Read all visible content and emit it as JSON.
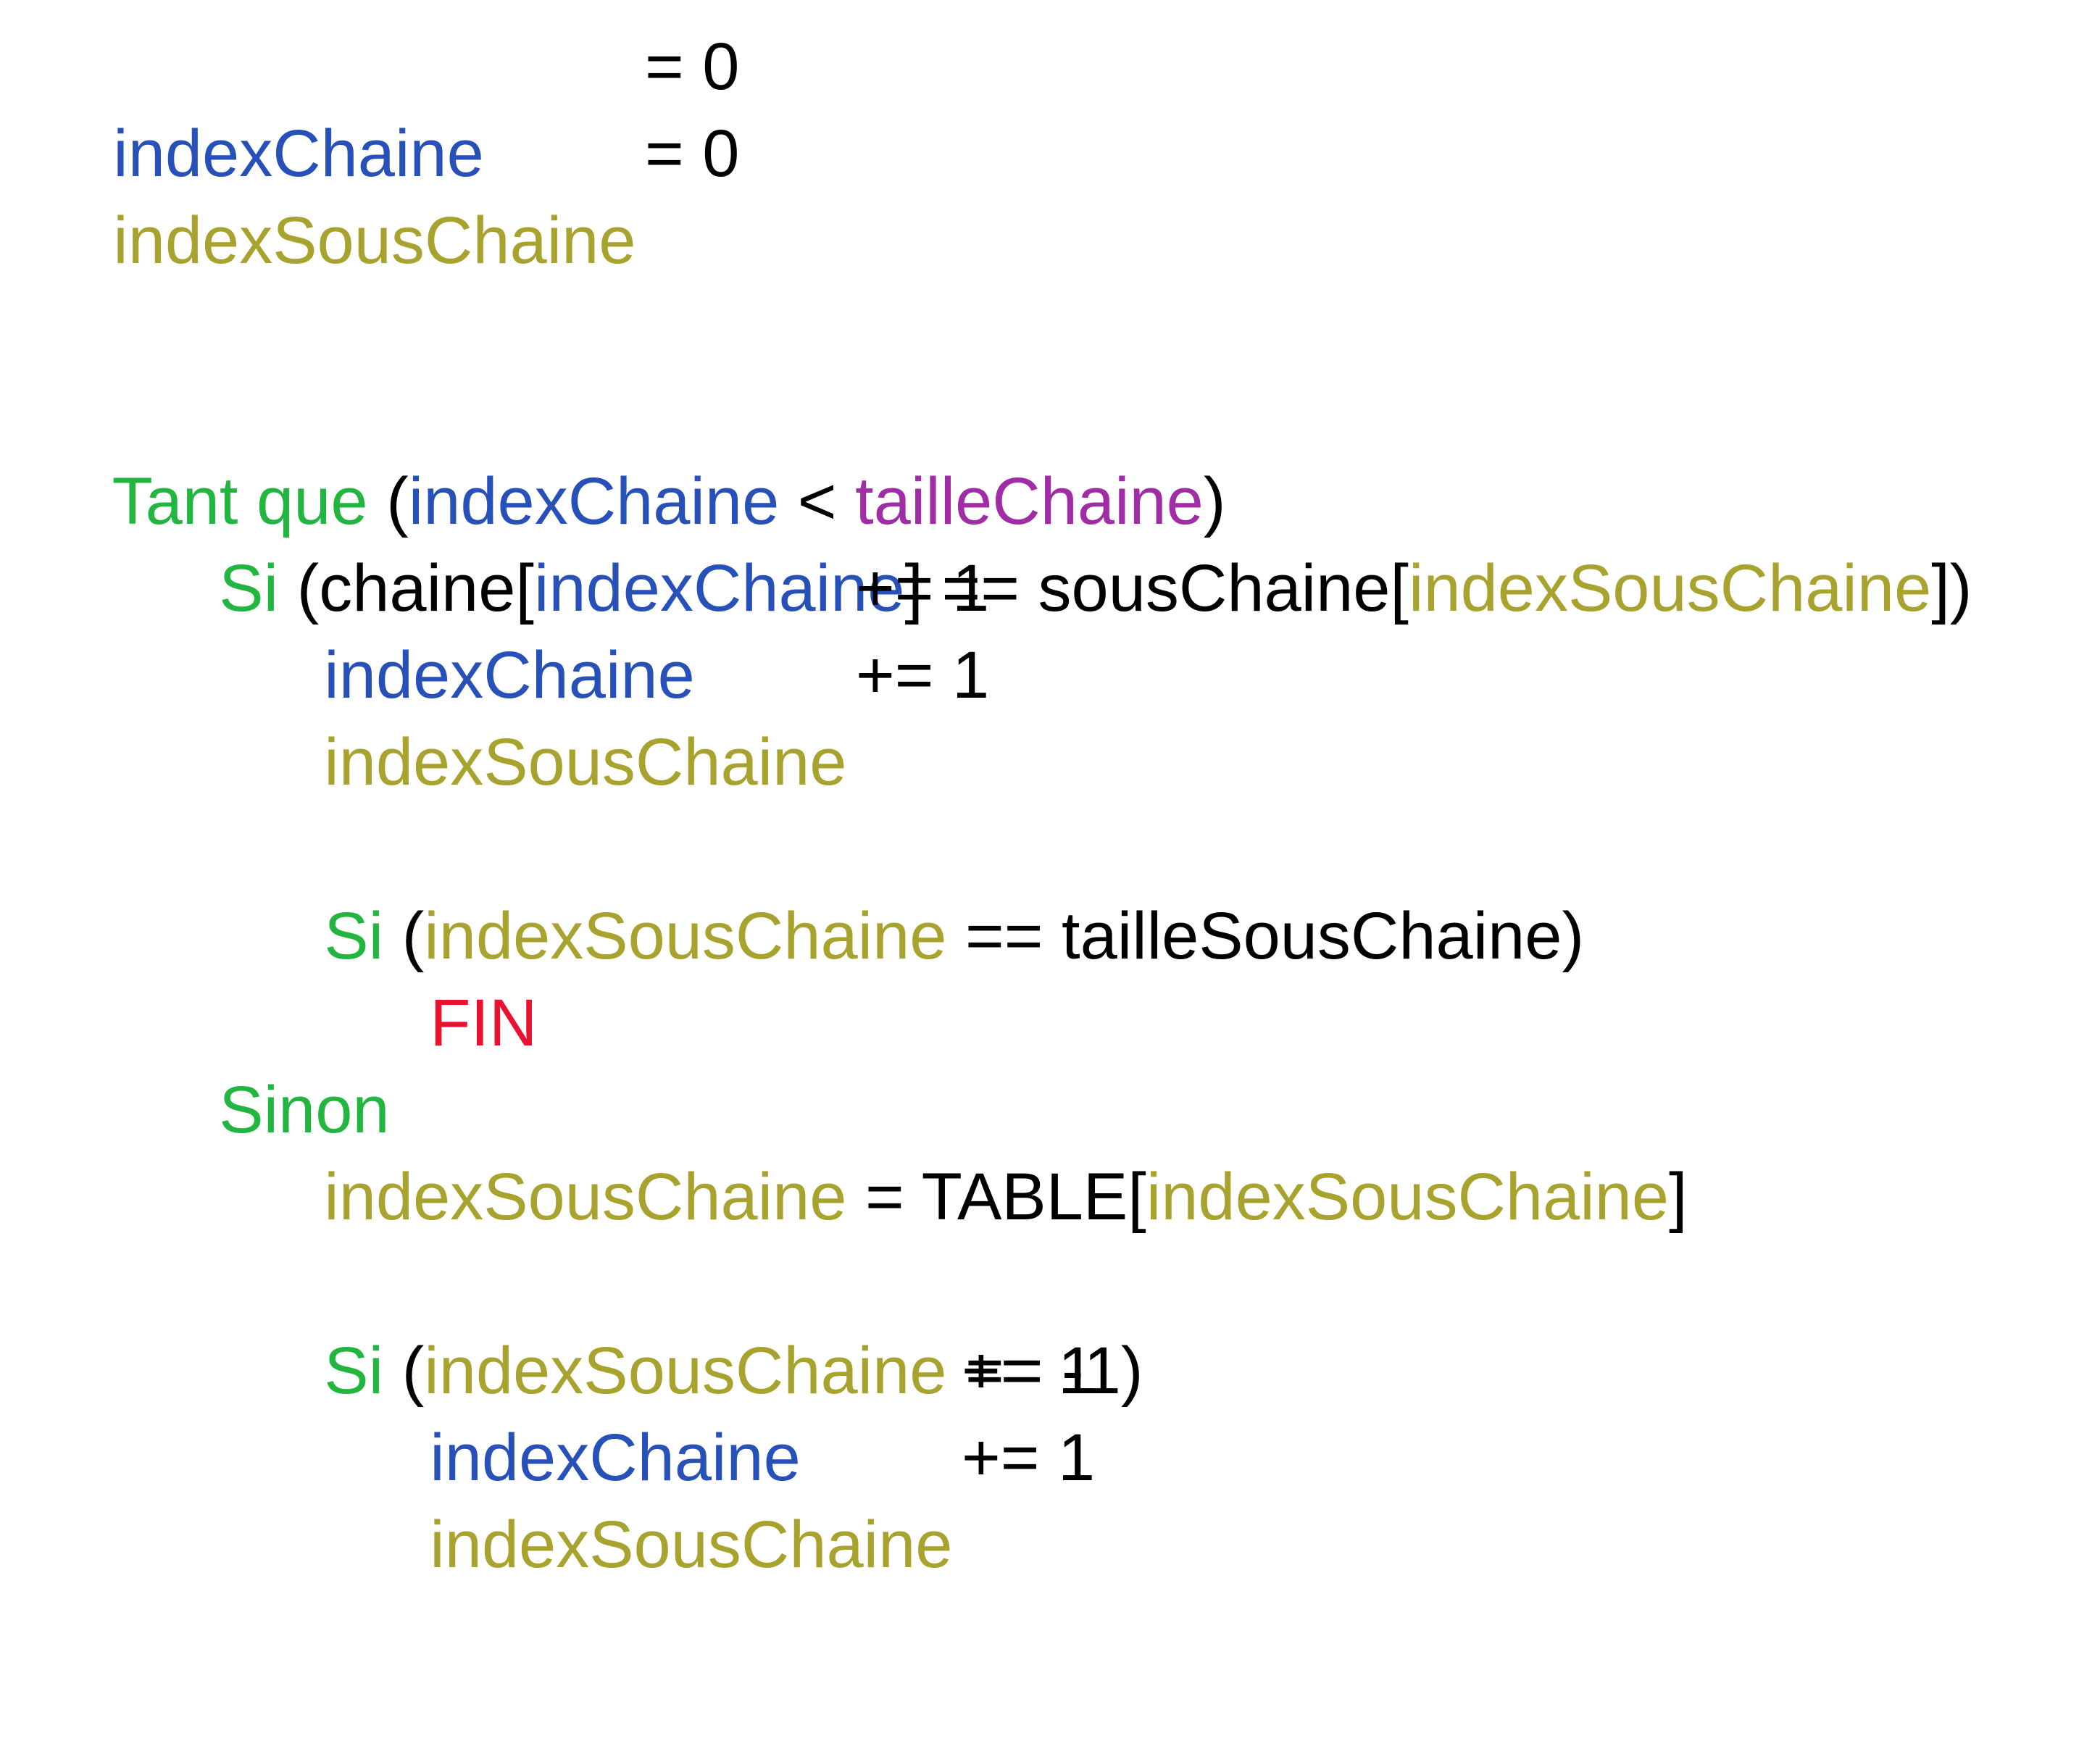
{
  "colors": {
    "variable_index_chaine": "#2750b8",
    "variable_index_sous_chaine": "#a8a22e",
    "keyword": "#22b540",
    "constant": "#a12da6",
    "end_statement": "#e8112f",
    "default": "#000000"
  },
  "lines": [
    [
      {
        "text": "indexChaine",
        "color": "#2750b8"
      },
      {
        "text": "= 0",
        "color": "#000000",
        "col": 890
      }
    ],
    [
      {
        "text": "indexSousChaine",
        "color": "#a8a22e"
      },
      {
        "text": "= 0",
        "color": "#000000",
        "col": 890
      }
    ],
    [],
    [],
    [
      {
        "text": "Tant que",
        "color": "#22b540"
      },
      {
        "text": " (",
        "color": "#000000"
      },
      {
        "text": "indexChaine",
        "color": "#2750b8"
      },
      {
        "text": " < ",
        "color": "#000000"
      },
      {
        "text": "tailleChaine",
        "color": "#a12da6"
      },
      {
        "text": ")",
        "color": "#000000"
      }
    ],
    [
      {
        "text": "Si",
        "color": "#22b540"
      },
      {
        "text": " (chaine[",
        "color": "#000000"
      },
      {
        "text": "indexChaine",
        "color": "#2750b8"
      },
      {
        "text": "] == sousChaine[",
        "color": "#000000"
      },
      {
        "text": "indexSousChaine",
        "color": "#a8a22e"
      },
      {
        "text": "])",
        "color": "#000000"
      }
    ],
    [
      {
        "text": "indexChaine",
        "color": "#2750b8"
      },
      {
        "text": "+= 1",
        "color": "#000000",
        "col": 890
      }
    ],
    [
      {
        "text": "indexSousChaine",
        "color": "#a8a22e"
      },
      {
        "text": "+= 1",
        "color": "#000000",
        "col": 890
      }
    ],
    [],
    [
      {
        "text": "Si",
        "color": "#22b540"
      },
      {
        "text": " (",
        "color": "#000000"
      },
      {
        "text": "indexSousChaine",
        "color": "#a8a22e"
      },
      {
        "text": " == tailleSousChaine)",
        "color": "#000000"
      }
    ],
    [
      {
        "text": "FIN",
        "color": "#e8112f"
      }
    ],
    [
      {
        "text": "Sinon",
        "color": "#22b540"
      }
    ],
    [
      {
        "text": "indexSousChaine",
        "color": "#a8a22e"
      },
      {
        "text": " = TABLE[",
        "color": "#000000"
      },
      {
        "text": "indexSousChaine",
        "color": "#a8a22e"
      },
      {
        "text": "]",
        "color": "#000000"
      }
    ],
    [],
    [
      {
        "text": "Si",
        "color": "#22b540"
      },
      {
        "text": " (",
        "color": "#000000"
      },
      {
        "text": "indexSousChaine",
        "color": "#a8a22e"
      },
      {
        "text": " == -1)",
        "color": "#000000"
      }
    ],
    [
      {
        "text": "indexChaine",
        "color": "#2750b8"
      },
      {
        "text": "+= 1",
        "color": "#000000",
        "col": 890
      }
    ],
    [
      {
        "text": "indexSousChaine",
        "color": "#a8a22e"
      },
      {
        "text": "+= 1",
        "color": "#000000",
        "col": 890
      }
    ]
  ]
}
